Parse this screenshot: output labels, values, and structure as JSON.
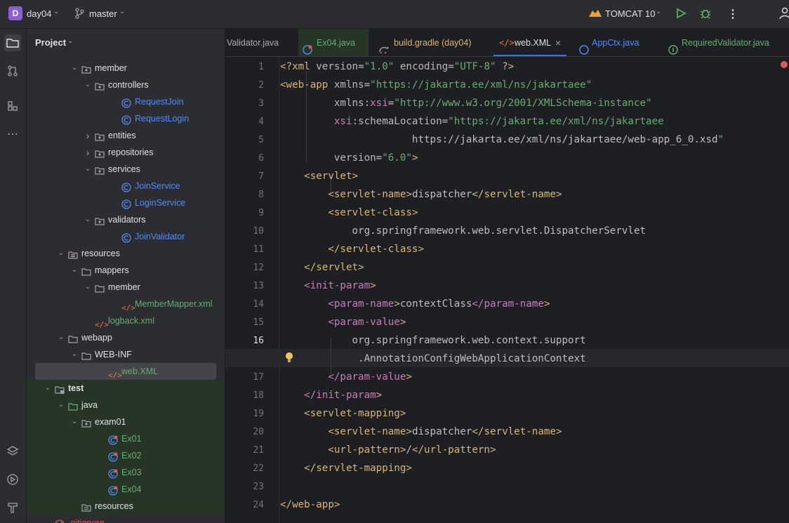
{
  "titlebar": {
    "project_badge": "D",
    "project_name": "day04",
    "branch": "master",
    "run_config": "TOMCAT 10"
  },
  "project_panel": {
    "title": "Project",
    "tree": [
      {
        "label": "member",
        "type": "pkg",
        "arrow": "down"
      },
      {
        "label": "controllers",
        "type": "pkg",
        "arrow": "down"
      },
      {
        "label": "RequestJoin",
        "type": "class",
        "arrow": ""
      },
      {
        "label": "RequestLogin",
        "type": "class",
        "arrow": ""
      },
      {
        "label": "entities",
        "type": "pkg",
        "arrow": "right"
      },
      {
        "label": "repositories",
        "type": "pkg",
        "arrow": "right"
      },
      {
        "label": "services",
        "type": "pkg",
        "arrow": "down"
      },
      {
        "label": "JoinService",
        "type": "class",
        "arrow": ""
      },
      {
        "label": "LoginService",
        "type": "class",
        "arrow": ""
      },
      {
        "label": "validators",
        "type": "pkg",
        "arrow": "down"
      },
      {
        "label": "JoinValidator",
        "type": "class",
        "arrow": ""
      },
      {
        "label": "resources",
        "type": "res",
        "arrow": "down"
      },
      {
        "label": "mappers",
        "type": "folder",
        "arrow": "down"
      },
      {
        "label": "member",
        "type": "folder",
        "arrow": "down"
      },
      {
        "label": "MemberMapper.xml",
        "type": "xml",
        "arrow": ""
      },
      {
        "label": "logback.xml",
        "type": "xml",
        "arrow": ""
      },
      {
        "label": "webapp",
        "type": "folder",
        "arrow": "down"
      },
      {
        "label": "WEB-INF",
        "type": "folder",
        "arrow": "down"
      },
      {
        "label": "web.XML",
        "type": "webxml",
        "arrow": ""
      },
      {
        "label": "test",
        "type": "testfolder",
        "arrow": "down"
      },
      {
        "label": "java",
        "type": "greenfolder",
        "arrow": "down"
      },
      {
        "label": "exam01",
        "type": "pkg",
        "arrow": "down"
      },
      {
        "label": "Ex01",
        "type": "testclass",
        "arrow": ""
      },
      {
        "label": "Ex02",
        "type": "testclass",
        "arrow": ""
      },
      {
        "label": "Ex03",
        "type": "testclass",
        "arrow": ""
      },
      {
        "label": "Ex04",
        "type": "testclass",
        "arrow": ""
      },
      {
        "label": "resources",
        "type": "testres",
        "arrow": ""
      },
      {
        "label": ".gitignore",
        "type": "git",
        "arrow": ""
      }
    ]
  },
  "tabs": [
    {
      "label": "Validator.java",
      "icon": "interface-icon"
    },
    {
      "label": "Ex04.java",
      "icon": "test-class-icon"
    },
    {
      "label": "build.gradle (day04)",
      "icon": "gradle-icon"
    },
    {
      "label": "web.XML",
      "icon": "xml-icon",
      "active": true
    },
    {
      "label": "AppCtx.java",
      "icon": "class-icon"
    },
    {
      "label": "RequiredValidator.java",
      "icon": "interface-icon"
    }
  ],
  "editor": {
    "line_numbers": [
      "1",
      "2",
      "3",
      "4",
      "5",
      "6",
      "7",
      "8",
      "9",
      "10",
      "11",
      "12",
      "13",
      "14",
      "15",
      "16",
      "",
      "17",
      "18",
      "19",
      "20",
      "21",
      "22",
      "23",
      "24"
    ],
    "lines": [
      "<?xml version=\"1.0\" encoding=\"UTF-8\" ?>",
      "<web-app xmlns=\"https://jakarta.ee/xml/ns/jakartaee\"",
      "         xmlns:xsi=\"http://www.w3.org/2001/XMLSchema-instance\"",
      "         xsi:schemaLocation=\"https://jakarta.ee/xml/ns/jakartaee",
      "                      https://jakarta.ee/xml/ns/jakartaee/web-app_6_0.xsd\"",
      "         version=\"6.0\">",
      "    <servlet>",
      "        <servlet-name>dispatcher</servlet-name>",
      "        <servlet-class>",
      "            org.springframework.web.servlet.DispatcherServlet",
      "        </servlet-class>",
      "    </servlet>",
      "    <init-param>",
      "        <param-name>contextClass</param-name>",
      "        <param-value>",
      "            org.springframework.web.context.support",
      "             .AnnotationConfigWebApplicationContext",
      "        </param-value>",
      "    </init-param>",
      "    <servlet-mapping>",
      "        <servlet-name>dispatcher</servlet-name>",
      "        <url-pattern>/</url-pattern>",
      "    </servlet-mapping>",
      "",
      "</web-app>"
    ]
  }
}
